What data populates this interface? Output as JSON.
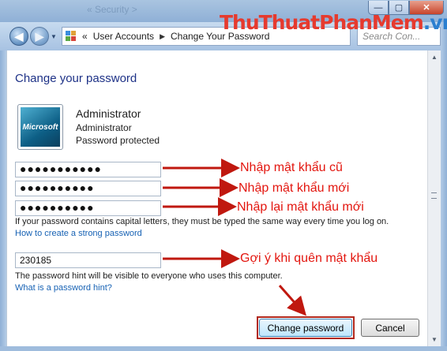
{
  "window": {
    "title_ghost": "« Security >",
    "controls": {
      "minimize": "—",
      "maximize": "▢",
      "close": "✕"
    }
  },
  "nav": {
    "back_icon": "◀",
    "forward_icon": "▶",
    "address_prefix": "«",
    "breadcrumb": [
      "User Accounts",
      "Change Your Password"
    ],
    "breadcrumb_sep": "▶",
    "search_placeholder": "Search Con..."
  },
  "watermark": {
    "part1": "ThuThuat",
    "part2": "PhanMem",
    "part3": ".vn"
  },
  "page": {
    "heading": "Change your password",
    "user": {
      "name": "Administrator",
      "role": "Administrator",
      "status": "Password protected",
      "avatar_text": "Microsoft"
    },
    "fields": {
      "current_password": "●●●●●●●●●●●",
      "new_password": "●●●●●●●●●●",
      "confirm_password": "●●●●●●●●●●",
      "hint": "230185"
    },
    "caps_notice": "If your password contains capital letters, they must be typed the same way every time you log on.",
    "strong_password_link": "How to create a strong password",
    "hint_notice": "The password hint will be visible to everyone who uses this computer.",
    "hint_link": "What is a password hint?",
    "buttons": {
      "change": "Change password",
      "cancel": "Cancel"
    }
  },
  "annotations": {
    "current": "Nhập mật khẩu cũ",
    "new": "Nhập mật khẩu mới",
    "confirm": "Nhập lại mật khẩu mới",
    "hint": "Gợi ý khi quên mật khẩu"
  },
  "colors": {
    "annotation": "#e3160f",
    "link": "#1762b4",
    "heading": "#1e3287"
  }
}
